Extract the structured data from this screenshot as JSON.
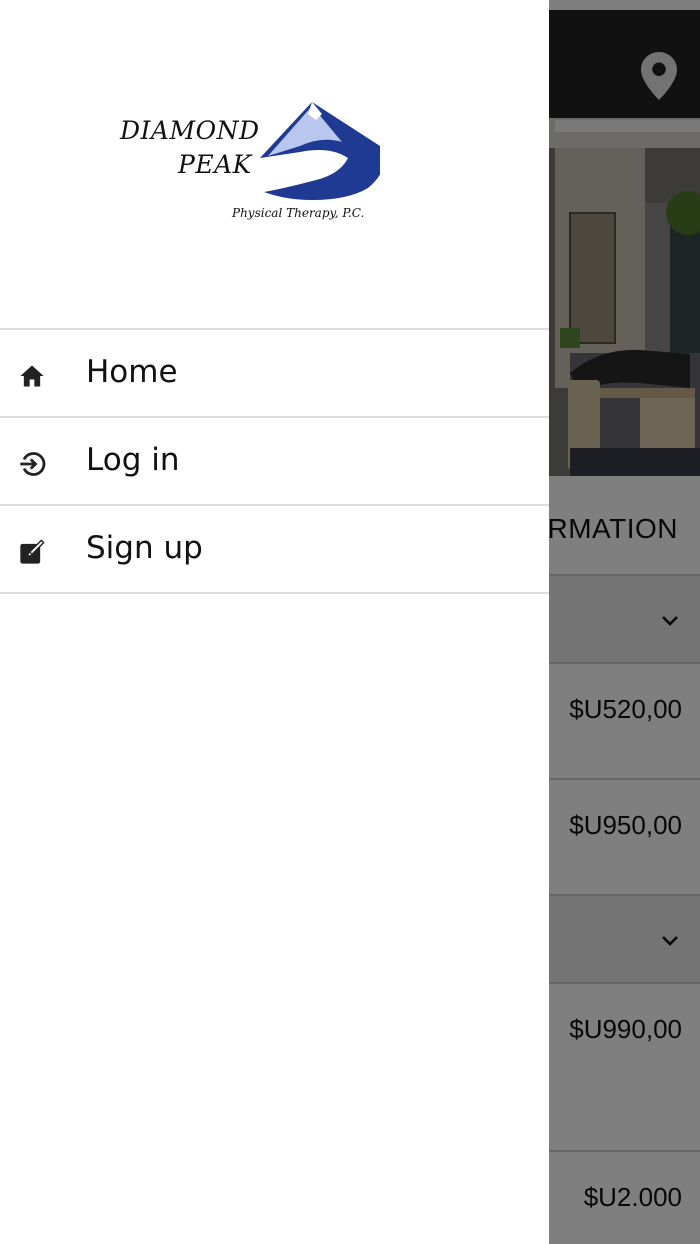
{
  "brand": {
    "logo_line1": "DIAMOND",
    "logo_line2": "PEAK",
    "logo_tagline": "Physical Therapy, P.C.",
    "accent_blue": "#1f3a93",
    "accent_light_blue": "#b9c6ee"
  },
  "drawer": {
    "items": [
      {
        "label": "Home",
        "icon": "home-icon"
      },
      {
        "label": "Log in",
        "icon": "login-icon"
      },
      {
        "label": "Sign up",
        "icon": "edit-icon"
      }
    ]
  },
  "header": {
    "location_icon": "location-pin-icon"
  },
  "hero": {
    "slide_count": 2,
    "active_slide": 1
  },
  "main": {
    "section_title": "RMATION",
    "rows": [
      {
        "type": "category",
        "icon": "chevron-down-icon"
      },
      {
        "type": "price",
        "price": "$U520,00"
      },
      {
        "type": "price",
        "price": "$U950,00"
      },
      {
        "type": "category",
        "icon": "chevron-down-icon"
      },
      {
        "type": "price",
        "price": "$U990,00"
      },
      {
        "type": "price",
        "price": "$U2.000"
      }
    ]
  },
  "colors": {
    "header_bg": "#222222",
    "scrim": "rgba(0,0,0,0.5)",
    "divider": "#dedede"
  }
}
